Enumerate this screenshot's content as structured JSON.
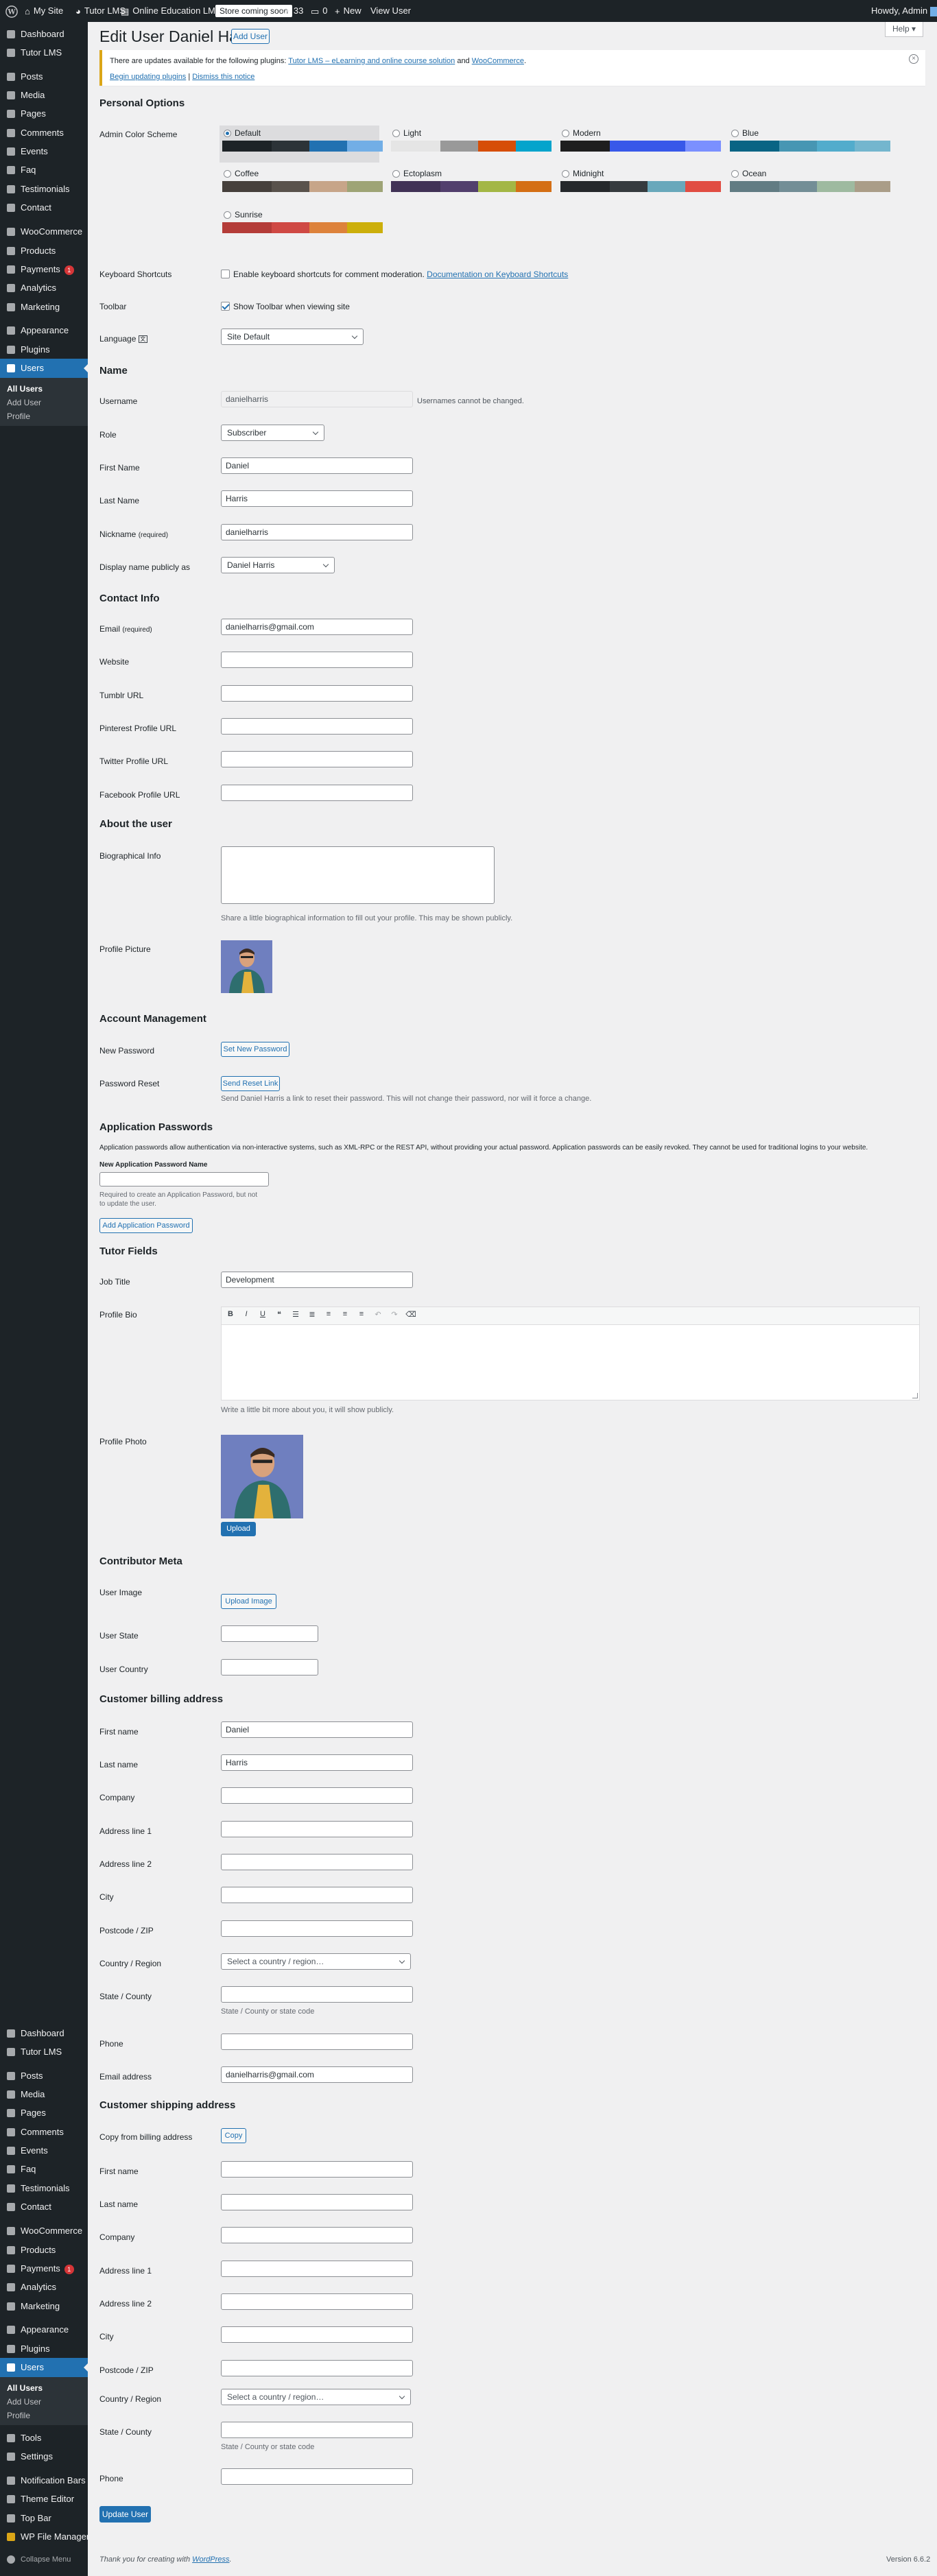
{
  "admin_bar": {
    "site": "My Site",
    "lms": "Tutor LMS",
    "course": "Online Education LMS Pro",
    "coming_soon": "Store coming soon",
    "updates": "33",
    "comments": "0",
    "new": "New",
    "view_user": "View User",
    "howdy": "Howdy, Admin"
  },
  "menu": {
    "items": [
      "Dashboard",
      "Tutor LMS",
      "Posts",
      "Media",
      "Pages",
      "Comments",
      "Events",
      "Faq",
      "Testimonials",
      "Contact",
      "WooCommerce",
      "Products",
      "Payments",
      "Analytics",
      "Marketing",
      "Appearance",
      "Plugins",
      "Users"
    ],
    "payments_badge": "1",
    "users_sub": [
      "All Users",
      "Add User",
      "Profile"
    ]
  },
  "menu2": {
    "items": [
      "Dashboard",
      "Tutor LMS",
      "Posts",
      "Media",
      "Pages",
      "Comments",
      "Events",
      "Faq",
      "Testimonials",
      "Contact",
      "WooCommerce",
      "Products",
      "Payments",
      "Analytics",
      "Marketing",
      "Appearance",
      "Plugins",
      "Users",
      "Tools",
      "Settings",
      "Notification Bars",
      "Theme Editor",
      "Top Bar",
      "WP File Manager",
      "Collapse Menu"
    ],
    "payments_badge": "1",
    "users_sub": [
      "All Users",
      "Add User",
      "Profile"
    ]
  },
  "header": {
    "title": "Edit User Daniel Harris",
    "add_user": "Add User",
    "help": "Help"
  },
  "notice": {
    "text_pre": "There are updates available for the following plugins: ",
    "link1": "Tutor LMS – eLearning and online course solution",
    "and": " and ",
    "link2": "WooCommerce",
    "dot": ".",
    "begin": "Begin updating plugins",
    "sep": " | ",
    "dismiss": "Dismiss this notice"
  },
  "personal": {
    "heading": "Personal Options",
    "color_scheme": "Admin Color Scheme",
    "schemes": [
      {
        "name": "Default",
        "colors": [
          "#1d2327",
          "#2c3338",
          "#2271b1",
          "#72aee6"
        ]
      },
      {
        "name": "Light",
        "colors": [
          "#e5e5e5",
          "#999999",
          "#d64e07",
          "#04a4cc"
        ]
      },
      {
        "name": "Modern",
        "colors": [
          "#1e1e1e",
          "#3858e9",
          "#3858e9",
          "#7b90ff"
        ]
      },
      {
        "name": "Blue",
        "colors": [
          "#096484",
          "#4796b3",
          "#52accc",
          "#74b6ce"
        ]
      },
      {
        "name": "Coffee",
        "colors": [
          "#46403c",
          "#59524c",
          "#c7a589",
          "#9ea476"
        ]
      },
      {
        "name": "Ectoplasm",
        "colors": [
          "#413256",
          "#523f6d",
          "#a3b745",
          "#d46f15"
        ]
      },
      {
        "name": "Midnight",
        "colors": [
          "#25282b",
          "#363b3f",
          "#69a8bb",
          "#e14d43"
        ]
      },
      {
        "name": "Ocean",
        "colors": [
          "#627c83",
          "#738e96",
          "#9ebaa0",
          "#aa9d88"
        ]
      },
      {
        "name": "Sunrise",
        "colors": [
          "#b43c38",
          "#cf4944",
          "#dd823b",
          "#ccaf0b"
        ]
      }
    ],
    "keyboard": "Keyboard Shortcuts",
    "keyboard_cb": "Enable keyboard shortcuts for comment moderation.",
    "keyboard_link": "Documentation on Keyboard Shortcuts",
    "toolbar": "Toolbar",
    "toolbar_cb": "Show Toolbar when viewing site",
    "language": "Language",
    "language_val": "Site Default"
  },
  "name": {
    "heading": "Name",
    "username": "Username",
    "username_val": "danielharris",
    "username_note": "Usernames cannot be changed.",
    "role": "Role",
    "role_val": "Subscriber",
    "first": "First Name",
    "first_val": "Daniel",
    "last": "Last Name",
    "last_val": "Harris",
    "nick": "Nickname",
    "nick_req": "(required)",
    "nick_val": "danielharris",
    "display": "Display name publicly as",
    "display_val": "Daniel Harris"
  },
  "contact": {
    "heading": "Contact Info",
    "email": "Email",
    "email_req": "(required)",
    "email_val": "danielharris@gmail.com",
    "website": "Website",
    "tumblr": "Tumblr URL",
    "pinterest": "Pinterest Profile URL",
    "twitter": "Twitter Profile URL",
    "facebook": "Facebook Profile URL"
  },
  "about": {
    "heading": "About the user",
    "bio": "Biographical Info",
    "bio_desc": "Share a little biographical information to fill out your profile. This may be shown publicly.",
    "pic": "Profile Picture"
  },
  "account": {
    "heading": "Account Management",
    "newpass": "New Password",
    "setpass": "Set New Password",
    "reset": "Password Reset",
    "sendreset": "Send Reset Link",
    "reset_desc": "Send Daniel Harris a link to reset their password. This will not change their password, nor will it force a change."
  },
  "apppass": {
    "heading": "Application Passwords",
    "desc": "Application passwords allow authentication via non-interactive systems, such as XML-RPC or the REST API, without providing your actual password. Application passwords can be easily revoked. They cannot be used for traditional logins to your website.",
    "name_label": "New Application Password Name",
    "req1": "Required to create an Application Password, but not",
    "req2": "to update the user.",
    "add": "Add Application Password"
  },
  "tutor": {
    "heading": "Tutor Fields",
    "job": "Job Title",
    "job_val": "Development",
    "bio": "Profile Bio",
    "bio_desc": "Write a little bit more about you, it will show publicly.",
    "photo": "Profile Photo",
    "upload": "Upload"
  },
  "contrib": {
    "heading": "Contributor Meta",
    "image": "User Image",
    "upload_image": "Upload Image",
    "state": "User State",
    "country": "User Country"
  },
  "billing": {
    "heading": "Customer billing address",
    "first": "First name",
    "first_val": "Daniel",
    "last": "Last name",
    "last_val": "Harris",
    "company": "Company",
    "addr1": "Address line 1",
    "addr2": "Address line 2",
    "city": "City",
    "postcode": "Postcode / ZIP",
    "country": "Country / Region",
    "country_ph": "Select a country / region…",
    "state": "State / County",
    "state_desc": "State / County or state code",
    "phone": "Phone",
    "email": "Email address",
    "email_val": "danielharris@gmail.com"
  },
  "shipping": {
    "heading": "Customer shipping address",
    "copy_label": "Copy from billing address",
    "copy": "Copy",
    "first": "First name",
    "last": "Last name",
    "company": "Company",
    "addr1": "Address line 1",
    "addr2": "Address line 2",
    "city": "City",
    "postcode": "Postcode / ZIP",
    "country": "Country / Region",
    "country_ph": "Select a country / region…",
    "state": "State / County",
    "state_desc": "State / County or state code",
    "phone": "Phone"
  },
  "footer": {
    "update": "Update User",
    "thanks": "Thank you for creating with ",
    "wp": "WordPress",
    "dot": ".",
    "version": "Version 6.6.2"
  }
}
